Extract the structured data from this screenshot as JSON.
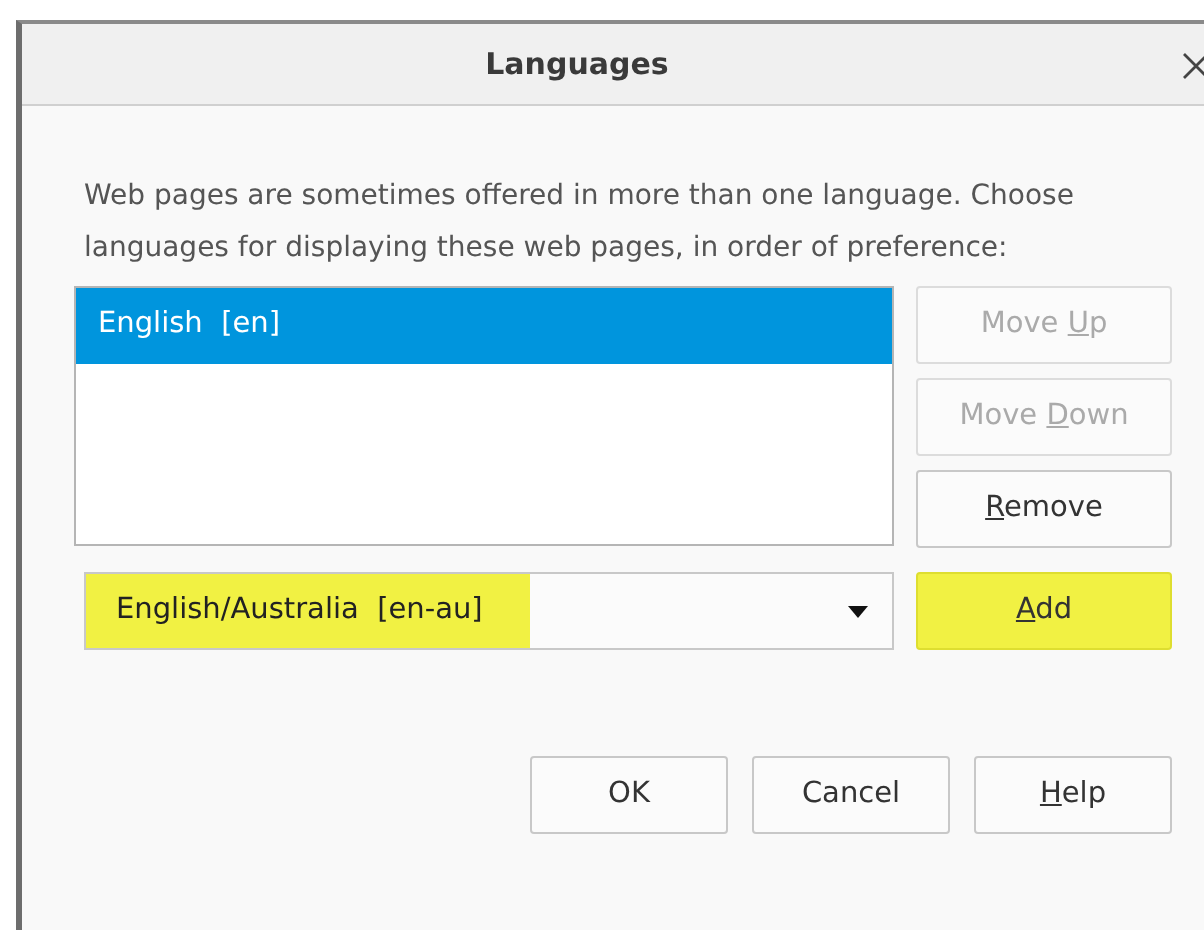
{
  "window": {
    "title": "Languages"
  },
  "description": "Web pages are sometimes offered in more than one language. Choose languages for displaying these web pages, in order of preference:",
  "languages": [
    {
      "label": "English  [en]",
      "selected": true
    }
  ],
  "side_buttons": [
    {
      "before": "Move ",
      "key": "U",
      "after": "p",
      "disabled": true
    },
    {
      "before": "Move ",
      "key": "D",
      "after": "own",
      "disabled": true
    },
    {
      "key": "R",
      "after": "emove",
      "disabled": false
    }
  ],
  "language_select": {
    "value": "English/Australia  [en-au]",
    "highlighted": true
  },
  "add_button": {
    "key": "A",
    "after": "dd",
    "highlighted": true
  },
  "footer_buttons": [
    {
      "before": "OK"
    },
    {
      "before": "Cancel"
    },
    {
      "key": "H",
      "after": "elp"
    }
  ]
}
